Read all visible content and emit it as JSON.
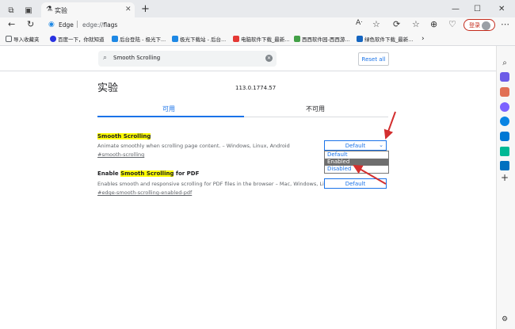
{
  "tab": {
    "title": "实验"
  },
  "address": {
    "brand": "Edge",
    "url_prefix": "edge://",
    "url_path": "flags"
  },
  "signin": {
    "label": "登录"
  },
  "bookmarks": [
    {
      "label": "导入收藏夹",
      "color": "#5f6368"
    },
    {
      "label": "百度一下，你就知道",
      "color": "#2932e1"
    },
    {
      "label": "后台登陆 - 极光下...",
      "color": "#1e88e5"
    },
    {
      "label": "极光下载站 - 后台...",
      "color": "#1e88e5"
    },
    {
      "label": "电脑软件下载_最新...",
      "color": "#e53935"
    },
    {
      "label": "西西软件园-西西游...",
      "color": "#43a047"
    },
    {
      "label": "绿色软件下载_最新...",
      "color": "#1565c0"
    }
  ],
  "search": {
    "value": "Smooth Scrolling"
  },
  "reset_label": "Reset all",
  "page": {
    "heading": "实验",
    "version": "113.0.1774.57"
  },
  "tabs": {
    "available": "可用",
    "unavailable": "不可用"
  },
  "flags": [
    {
      "title_highlight": "Smooth Scrolling",
      "title_pre": "",
      "title_post": "",
      "description": "Animate smoothly when scrolling page content. – Windows, Linux, Android",
      "link": "#smooth-scrolling",
      "value": "Default"
    },
    {
      "title_pre": "Enable ",
      "title_highlight": "Smooth Scrolling",
      "title_post": " for PDF",
      "description": "Enables smooth and responsive scrolling for PDF files in the browser – Mac, Windows, Linux",
      "link": "#edge-smooth-scrolling-enabled-pdf",
      "value": "Default"
    }
  ],
  "dropdown_options": [
    "Default",
    "Enabled",
    "Disabled"
  ],
  "dropdown_highlighted": "Enabled",
  "colors": {
    "accent": "#1a73e8",
    "highlight": "#ffff00",
    "arrow": "#d32f2f"
  }
}
